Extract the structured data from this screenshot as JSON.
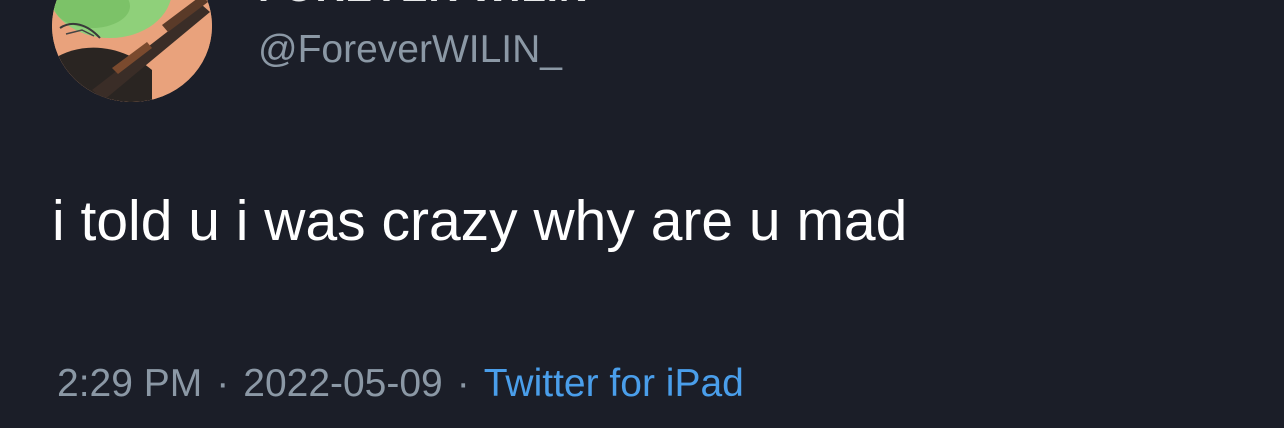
{
  "tweet": {
    "display_name": "FOREVER WILIN",
    "handle": "@ForeverWILIN_",
    "text": "i told u i was crazy why are u mad",
    "time": "2:29 PM",
    "date": "2022-05-09",
    "separator": "·",
    "source": "Twitter for iPad"
  },
  "colors": {
    "background": "#1b1e28",
    "text": "#ffffff",
    "secondary": "#8b98a5",
    "link": "#4a9eea"
  }
}
